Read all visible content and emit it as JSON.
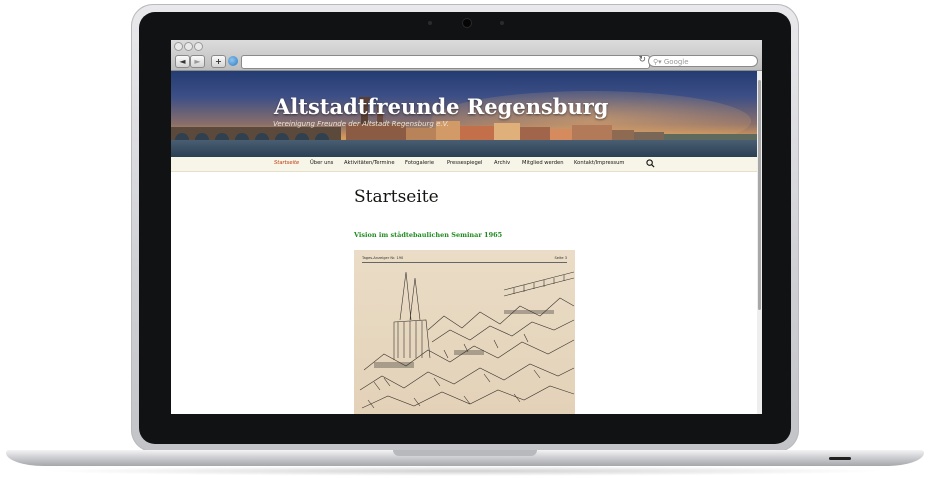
{
  "browser": {
    "search_placeholder": "Google",
    "back_label": "◄",
    "forward_label": "►",
    "add_label": "+",
    "reload_label": "↻"
  },
  "site": {
    "title": "Altstadtfreunde Regensburg",
    "description": "Vereinigung Freunde der Altstadt Regensburg e.V."
  },
  "nav": {
    "items": [
      {
        "label": "Startseite",
        "active": true
      },
      {
        "label": "Über uns"
      },
      {
        "label": "Aktivitäten/Termine"
      },
      {
        "label": "Fotogalerie"
      },
      {
        "label": "Pressespiegel"
      },
      {
        "label": "Archiv"
      },
      {
        "label": "Mitglied werden"
      },
      {
        "label": "Kontakt/Impressum"
      }
    ]
  },
  "main": {
    "page_title": "Startseite",
    "post_title": "Vision im städtebaulichen Seminar 1965",
    "clipping": {
      "header_left": "Tages-Anzeiger Nr. 190",
      "header_right": "Seite 3"
    }
  },
  "colors": {
    "nav_active": "#bc360a",
    "post_title": "#1e8a1e",
    "nav_background": "#f7f5e7"
  }
}
